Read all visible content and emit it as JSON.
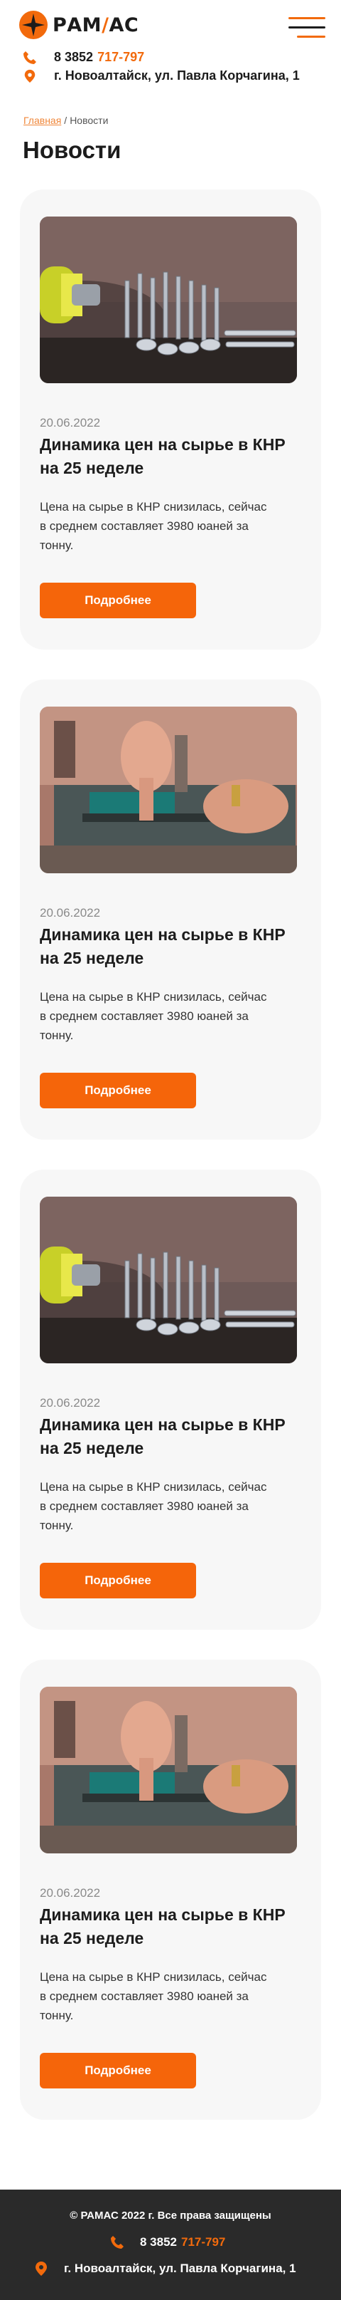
{
  "brand": {
    "name_left": "РАМ",
    "name_slash": "/",
    "name_right": "АС",
    "accent_color": "#f26a0c"
  },
  "header": {
    "phone_prefix": "8 3852",
    "phone_number": "717-797",
    "address": "г. Новоалтайск, ул. Павла Корчагина, 1",
    "menu_icon": "hamburger-icon"
  },
  "breadcrumb": {
    "home": "Главная",
    "separator": "/",
    "current": "Новости"
  },
  "page_title": "Новости",
  "news": [
    {
      "image": "screws-photo",
      "date": "20.06.2022",
      "title": "Динамика цен на сырье в КНР на 25 неделе",
      "text": "Цена на сырье в КНР снизилась, сейчас в среднем составляет 3980 юаней за тонну.",
      "button": "Подробнее"
    },
    {
      "image": "metalwork-photo",
      "date": "20.06.2022",
      "title": "Динамика цен на сырье в КНР на 25 неделе",
      "text": "Цена на сырье в КНР снизилась, сейчас в среднем составляет 3980 юаней за тонну.",
      "button": "Подробнее"
    },
    {
      "image": "screws-photo",
      "date": "20.06.2022",
      "title": "Динамика цен на сырье в КНР на 25 неделе",
      "text": "Цена на сырье в КНР снизилась, сейчас в среднем составляет 3980 юаней за тонну.",
      "button": "Подробнее"
    },
    {
      "image": "metalwork-photo",
      "date": "20.06.2022",
      "title": "Динамика цен на сырье в КНР на 25 неделе",
      "text": "Цена на сырье в КНР снизилась, сейчас в среднем составляет 3980 юаней за тонну.",
      "button": "Подробнее"
    }
  ],
  "footer": {
    "copyright": "© РАМАС 2022 г. Все права защищены",
    "phone_prefix": "8 3852",
    "phone_number": "717-797",
    "address": "г. Новоалтайск, ул. Павла Корчагина, 1"
  }
}
